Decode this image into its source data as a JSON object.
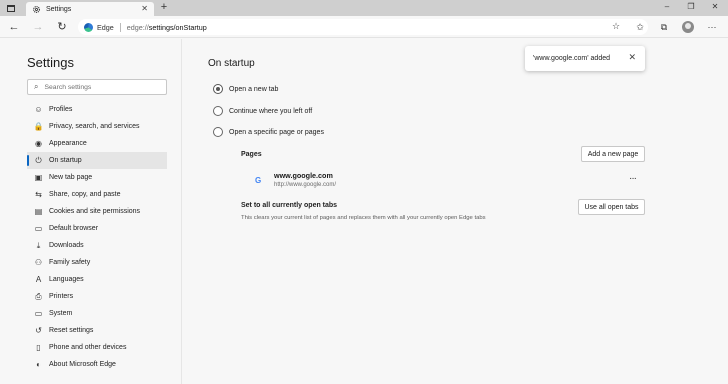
{
  "tab": {
    "title": "Settings",
    "close": "✕",
    "new_tab": "+"
  },
  "window_controls": {
    "minimize": "–",
    "maximize": "❐",
    "close": "✕"
  },
  "address_bar": {
    "site_label": "Edge",
    "url_prefix": "edge://",
    "url_path": "settings/onStartup"
  },
  "sidebar": {
    "heading": "Settings",
    "search_placeholder": "Search settings",
    "items": [
      {
        "label": "Profiles",
        "icon": "profile-icon",
        "glyph": "☺"
      },
      {
        "label": "Privacy, search, and services",
        "icon": "lock-icon",
        "glyph": "🔒"
      },
      {
        "label": "Appearance",
        "icon": "appearance-icon",
        "glyph": "◉"
      },
      {
        "label": "On startup",
        "icon": "power-icon",
        "glyph": "⏻",
        "active": true
      },
      {
        "label": "New tab page",
        "icon": "new-tab-page-icon",
        "glyph": "▣"
      },
      {
        "label": "Share, copy, and paste",
        "icon": "share-icon",
        "glyph": "⇆"
      },
      {
        "label": "Cookies and site permissions",
        "icon": "cookies-icon",
        "glyph": "▤"
      },
      {
        "label": "Default browser",
        "icon": "default-browser-icon",
        "glyph": "▭"
      },
      {
        "label": "Downloads",
        "icon": "download-icon",
        "glyph": "⤓"
      },
      {
        "label": "Family safety",
        "icon": "family-icon",
        "glyph": "⚇"
      },
      {
        "label": "Languages",
        "icon": "languages-icon",
        "glyph": "A"
      },
      {
        "label": "Printers",
        "icon": "printer-icon",
        "glyph": "⎙"
      },
      {
        "label": "System",
        "icon": "system-icon",
        "glyph": "▭"
      },
      {
        "label": "Reset settings",
        "icon": "reset-icon",
        "glyph": "↺"
      },
      {
        "label": "Phone and other devices",
        "icon": "phone-icon",
        "glyph": "▯"
      },
      {
        "label": "About Microsoft Edge",
        "icon": "edge-icon",
        "glyph": "◐"
      }
    ]
  },
  "main": {
    "title": "On startup",
    "options": [
      {
        "label": "Open a new tab",
        "checked": true
      },
      {
        "label": "Continue where you left off",
        "checked": false
      },
      {
        "label": "Open a specific page or pages",
        "checked": false
      }
    ],
    "pages_label": "Pages",
    "add_page_button": "Add a new page",
    "page": {
      "name": "www.google.com",
      "url": "http://www.google.com/",
      "icon": "G"
    },
    "more_button": "···",
    "set_all_title": "Set to all currently open tabs",
    "set_all_desc": "This clears your current list of pages and replaces them with all your currently open Edge tabs",
    "use_all_button": "Use all open tabs"
  },
  "toast": {
    "message": "'www.google.com' added",
    "close": "✕"
  },
  "colors": {
    "accent": "#0a66c2",
    "tabstrip": "#cfcfcf",
    "background": "#f7f7f7"
  }
}
